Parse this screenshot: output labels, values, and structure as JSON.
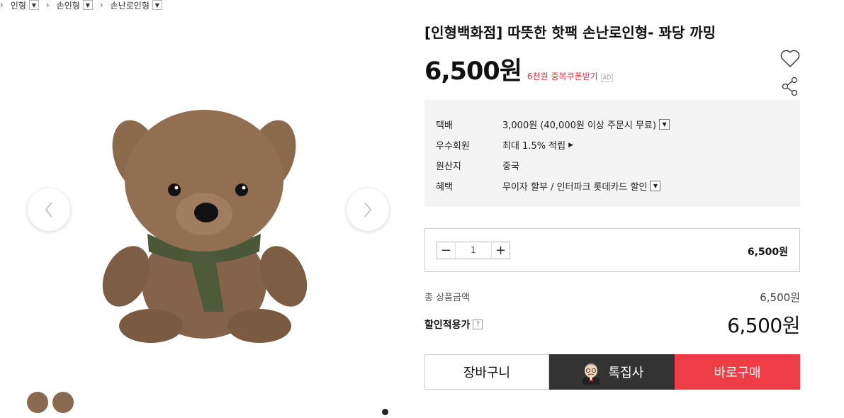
{
  "breadcrumb": [
    {
      "label": "인형"
    },
    {
      "label": "손인형"
    },
    {
      "label": "손난로인형"
    }
  ],
  "product": {
    "title": "[인형백화점] 따뜻한 핫팩 손난로인형- 꽈당 까밍",
    "price": "6,500원",
    "coupon_text": "6천원 중복쿠폰받기",
    "ad_label": "AD"
  },
  "delivery": [
    {
      "label": "택배",
      "value": "3,000원 (40,000원 이상 주문시 무료)",
      "control": "dropdown"
    },
    {
      "label": "우수회원",
      "value": "최대 1.5% 적립",
      "control": "arrow"
    },
    {
      "label": "원산지",
      "value": "중국",
      "control": "none"
    },
    {
      "label": "혜택",
      "value": "무이자 할부 / 인터파크 롯데카드 할인",
      "control": "dropdown"
    }
  ],
  "quantity": {
    "value": "1",
    "line_price": "6,500원"
  },
  "summary": {
    "total_label": "총 상품금액",
    "total_value": "6,500원",
    "discount_label": "할인적용가",
    "discount_help": "?",
    "final_price": "6,500원"
  },
  "actions": {
    "cart": "장바구니",
    "special": "톡집사",
    "buy": "바로구매"
  },
  "icons": {
    "crumb_dropdown": "chevron-down-icon",
    "wish": "heart-icon",
    "share": "share-icon",
    "prev": "chevron-left-icon",
    "next": "chevron-right-icon"
  },
  "colors": {
    "accent_red": "#ee3d46",
    "coupon_red": "#e0313a",
    "dark_button": "#333333",
    "info_bg": "#f4f4f4"
  }
}
